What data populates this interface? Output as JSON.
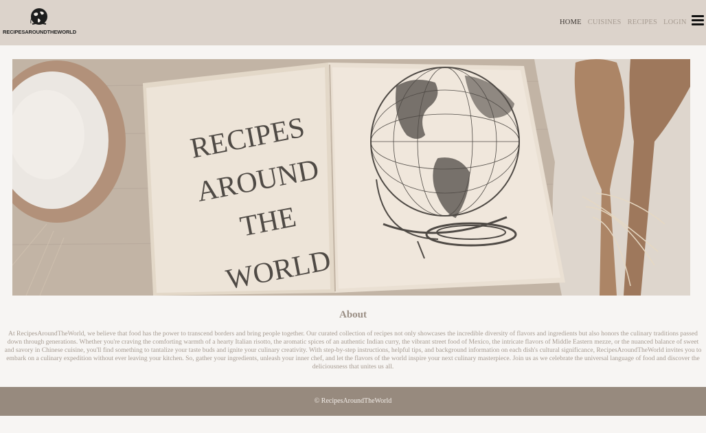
{
  "header": {
    "logo_text": "RECIPESAROUNDTHEWORLD",
    "nav": [
      {
        "label": "HOME",
        "active": true
      },
      {
        "label": "CUISINES",
        "active": false
      },
      {
        "label": "RECIPES",
        "active": false
      },
      {
        "label": "LOGIN",
        "active": false
      }
    ],
    "menu_icon": "hamburger-menu-icon"
  },
  "hero": {
    "book_lines": [
      "RECIPES",
      "AROUND",
      "THE",
      "WORLD"
    ]
  },
  "about": {
    "title": "About",
    "body": "At RecipesAroundTheWorld, we believe that food has the power to transcend borders and bring people together. Our curated collection of recipes not only showcases the incredible diversity of flavors and ingredients but also honors the culinary traditions passed down through generations. Whether you're craving the comforting warmth of a hearty Italian risotto, the aromatic spices of an authentic Indian curry, the vibrant street food of Mexico, the intricate flavors of Middle Eastern mezze, or the nuanced balance of sweet and savory in Chinese cuisine, you'll find something to tantalize your taste buds and ignite your culinary creativity. With step-by-step instructions, helpful tips, and background information on each dish's cultural significance, RecipesAroundTheWorld invites you to embark on a culinary expedition without ever leaving your kitchen. So, gather your ingredients, unleash your inner chef, and let the flavors of the world inspire your next culinary masterpiece. Join us as we celebrate the universal language of food and discover the deliciousness that unites us all."
  },
  "footer": {
    "copyright": "© RecipesAroundTheWorld"
  },
  "colors": {
    "header_bg": "#dcd3cb",
    "footer_bg": "#978a7e",
    "page_bg": "#f7f5f3",
    "muted_text": "#a69b91"
  }
}
